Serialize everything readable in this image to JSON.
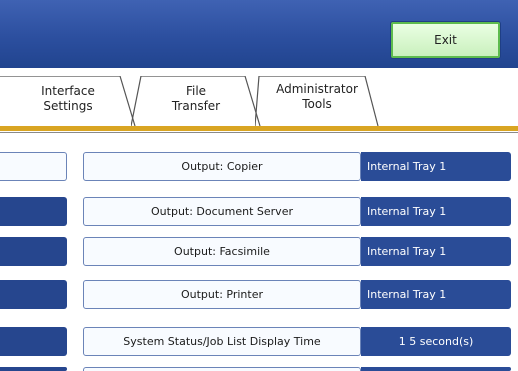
{
  "header": {
    "exit_label": "Exit"
  },
  "tabs": [
    {
      "line1": "Interface",
      "line2": "Settings"
    },
    {
      "line1": "File",
      "line2": "Transfer"
    },
    {
      "line1": "Administrator",
      "line2": "Tools"
    }
  ],
  "settings": [
    {
      "label": "Output: Copier",
      "value": "Internal Tray 1"
    },
    {
      "label": "Output: Document Server",
      "value": "Internal Tray 1"
    },
    {
      "label": "Output: Facsimile",
      "value": "Internal Tray 1"
    },
    {
      "label": "Output: Printer",
      "value": "Internal Tray 1"
    },
    {
      "label": "System Status/Job List Display Time",
      "value": "1 5 second(s)"
    }
  ],
  "colors": {
    "header_blue": "#2c4f9f",
    "accent_gold": "#d9a522",
    "exit_green": "#c9f0bd",
    "value_blue": "#2a4c97"
  }
}
